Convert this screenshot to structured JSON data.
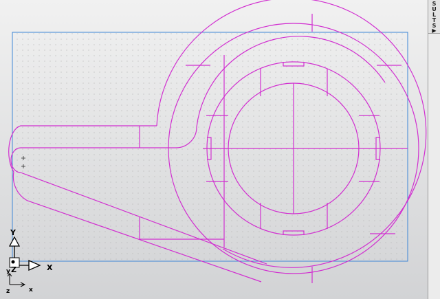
{
  "side_panel": {
    "tab_label": "SULTS",
    "tab_arrow": "▶"
  },
  "triad": {
    "x_label": "X",
    "y_label": "Y",
    "z_label": "Z"
  },
  "mini_triad": {
    "x_label": "x",
    "y_label": "y",
    "z_label": "z"
  },
  "colors": {
    "geometry": "#d12fd0",
    "frame": "#3d86d6",
    "grid_dot": "#b7b7b7",
    "triad_fill": "#ffffff",
    "triad_stroke": "#000000"
  }
}
